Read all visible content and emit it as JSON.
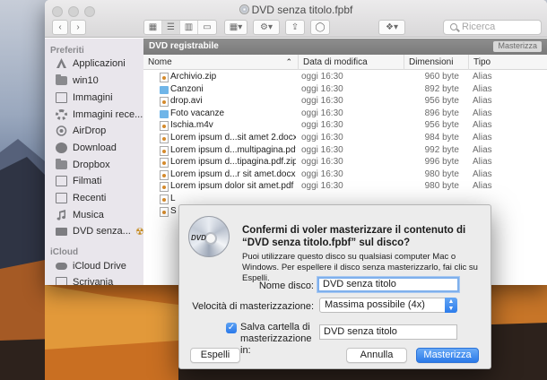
{
  "window": {
    "title": "DVD senza titolo.fpbf"
  },
  "toolbar": {
    "nav_back": "‹",
    "nav_forward": "›",
    "search_placeholder": "Ricerca"
  },
  "sidebar": {
    "section_favorites": "Preferiti",
    "items": [
      {
        "label": "Applicazioni",
        "icon": "applications-icon"
      },
      {
        "label": "win10",
        "icon": "folder-icon"
      },
      {
        "label": "Immagini",
        "icon": "camera-icon"
      },
      {
        "label": "Immagini rece...",
        "icon": "gear-icon"
      },
      {
        "label": "AirDrop",
        "icon": "airdrop-icon"
      },
      {
        "label": "Download",
        "icon": "download-icon"
      },
      {
        "label": "Dropbox",
        "icon": "folder-icon"
      },
      {
        "label": "Filmati",
        "icon": "film-icon"
      },
      {
        "label": "Recenti",
        "icon": "recents-icon"
      },
      {
        "label": "Musica",
        "icon": "music-icon"
      },
      {
        "label": "DVD senza...",
        "icon": "burn-folder-icon"
      }
    ],
    "section_icloud": "iCloud",
    "icloud_items": [
      {
        "label": "iCloud Drive",
        "icon": "cloud-icon"
      },
      {
        "label": "Scrivania",
        "icon": "desktop-icon"
      }
    ]
  },
  "burnbar": {
    "label": "DVD registrabile",
    "button": "Masterizza"
  },
  "columns": {
    "name": "Nome",
    "date": "Data di modifica",
    "size": "Dimensioni",
    "kind": "Tipo"
  },
  "files": [
    {
      "name": "Archivio.zip",
      "date": "oggi 16:30",
      "size": "960 byte",
      "kind": "Alias",
      "type": "doc"
    },
    {
      "name": "Canzoni",
      "date": "oggi 16:30",
      "size": "892 byte",
      "kind": "Alias",
      "type": "folder"
    },
    {
      "name": "drop.avi",
      "date": "oggi 16:30",
      "size": "956 byte",
      "kind": "Alias",
      "type": "doc"
    },
    {
      "name": "Foto vacanze",
      "date": "oggi 16:30",
      "size": "896 byte",
      "kind": "Alias",
      "type": "folder"
    },
    {
      "name": "Ischia.m4v",
      "date": "oggi 16:30",
      "size": "956 byte",
      "kind": "Alias",
      "type": "doc"
    },
    {
      "name": "Lorem ipsum d...sit amet 2.docx",
      "date": "oggi 16:30",
      "size": "984 byte",
      "kind": "Alias",
      "type": "doc"
    },
    {
      "name": "Lorem ipsum d...multipagina.pdf",
      "date": "oggi 16:30",
      "size": "992 byte",
      "kind": "Alias",
      "type": "doc"
    },
    {
      "name": "Lorem ipsum d...tipagina.pdf.zip",
      "date": "oggi 16:30",
      "size": "996 byte",
      "kind": "Alias",
      "type": "doc"
    },
    {
      "name": "Lorem ipsum d...r sit amet.docx",
      "date": "oggi 16:30",
      "size": "980 byte",
      "kind": "Alias",
      "type": "doc"
    },
    {
      "name": "Lorem ipsum dolor sit amet.pdf",
      "date": "oggi 16:30",
      "size": "980 byte",
      "kind": "Alias",
      "type": "doc"
    },
    {
      "name": "L",
      "date": "",
      "size": "",
      "kind": "",
      "type": "doc"
    },
    {
      "name": "S",
      "date": "",
      "size": "",
      "kind": "",
      "type": "doc"
    }
  ],
  "dialog": {
    "title": "Confermi di voler masterizzare il contenuto di “DVD senza titolo.fpbf” sul disco?",
    "info": "Puoi utilizzare questo disco su qualsiasi computer Mac o Windows. Per espellere il disco senza masterizzarlo, fai clic su Espelli.",
    "disc_name_label": "Nome disco:",
    "disc_name_value": "DVD senza titolo",
    "speed_label": "Velocità di masterizzazione:",
    "speed_value": "Massima possibile (4x)",
    "save_label": "Salva cartella di masterizzazione in:",
    "save_value": "DVD senza titolo",
    "dvd_icon_text": "DVD",
    "eject_button": "Espelli",
    "cancel_button": "Annulla",
    "burn_button": "Masterizza"
  }
}
